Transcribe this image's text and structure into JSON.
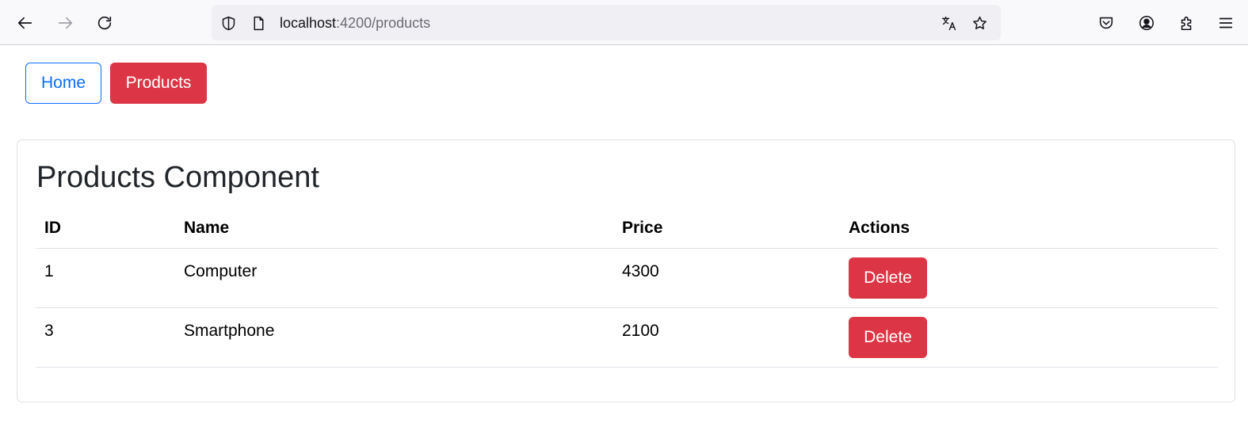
{
  "browser": {
    "url_host": "localhost",
    "url_path": ":4200/products",
    "icons": [
      "back-arrow-icon",
      "forward-arrow-icon",
      "reload-icon",
      "shield-icon",
      "page-icon",
      "translate-icon",
      "star-icon",
      "pocket-icon",
      "account-icon",
      "extensions-icon",
      "menu-icon"
    ]
  },
  "nav": {
    "home_label": "Home",
    "products_label": "Products"
  },
  "page": {
    "title": "Products Component",
    "columns": [
      "ID",
      "Name",
      "Price",
      "Actions"
    ],
    "rows": [
      {
        "id": "1",
        "name": "Computer",
        "price": "4300",
        "action": "Delete"
      },
      {
        "id": "3",
        "name": "Smartphone",
        "price": "2100",
        "action": "Delete"
      }
    ]
  },
  "colors": {
    "primary": "#0d6efd",
    "danger": "#dc3545"
  }
}
